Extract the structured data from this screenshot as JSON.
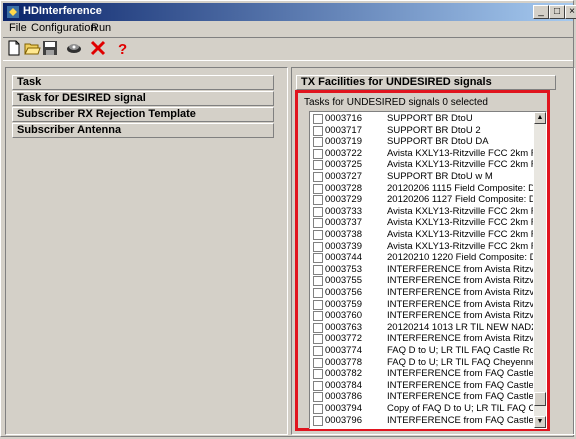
{
  "window": {
    "title": "HDInterference"
  },
  "menu": [
    "File",
    "Configuration",
    "Run"
  ],
  "toolbar": {
    "icons": [
      "new-document-icon",
      "open-folder-icon",
      "save-icon",
      "run-icon",
      "delete-icon",
      "help-icon"
    ]
  },
  "left": {
    "sections": [
      "Task",
      "Task for DESIRED signal",
      "Subscriber RX Rejection Template",
      "Subscriber Antenna"
    ]
  },
  "right": {
    "header": "TX Facilities for UNDESIRED signals",
    "subheader": "Tasks for UNDESIRED signals 0 selected",
    "rows": [
      {
        "id": "0003716",
        "name": "SUPPORT BR DtoU"
      },
      {
        "id": "0003717",
        "name": "SUPPORT BR DtoU 2"
      },
      {
        "id": "0003719",
        "name": "SUPPORT BR DtoU DA"
      },
      {
        "id": "0003722",
        "name": "Avista KXLY13-Ritzville FCC 2km R10"
      },
      {
        "id": "0003725",
        "name": "Avista KXLY13-Ritzville FCC 2km R10"
      },
      {
        "id": "0003727",
        "name": "SUPPORT BR DtoU w M"
      },
      {
        "id": "0003728",
        "name": "20120206 1115 Field Composite: D/U Ra"
      },
      {
        "id": "0003729",
        "name": "20120206 1127 Field Composite: D/U Ra"
      },
      {
        "id": "0003733",
        "name": "Avista KXLY13-Ritzville FCC 2km R10"
      },
      {
        "id": "0003737",
        "name": "Avista KXLY13-Ritzville FCC 2km R10"
      },
      {
        "id": "0003738",
        "name": "Avista KXLY13-Ritzville FCC 2km R10"
      },
      {
        "id": "0003739",
        "name": "Avista KXLY13-Ritzville FCC 2km R10"
      },
      {
        "id": "0003744",
        "name": "20120210 1220 Field Composite: D/U Ra"
      },
      {
        "id": "0003753",
        "name": "INTERFERENCE from Avista Ritzville Of"
      },
      {
        "id": "0003755",
        "name": "INTERFERENCE from Avista Ritzville Of"
      },
      {
        "id": "0003756",
        "name": "INTERFERENCE from Avista Ritzville Of"
      },
      {
        "id": "0003759",
        "name": "INTERFERENCE from Avista Ritzville Of"
      },
      {
        "id": "0003760",
        "name": "INTERFERENCE from Avista Ritzville Of"
      },
      {
        "id": "0003763",
        "name": "20120214 1013 LR TIL NEW NAD27 Ch"
      },
      {
        "id": "0003772",
        "name": "INTERFERENCE from Avista Ritzville Of"
      },
      {
        "id": "0003774",
        "name": "FAQ D to U; LR TIL FAQ Castle Rock Ch"
      },
      {
        "id": "0003778",
        "name": "FAQ D to U; LR TIL FAQ Cheyenne Mou"
      },
      {
        "id": "0003782",
        "name": "INTERFERENCE from FAQ Castle Rock"
      },
      {
        "id": "0003784",
        "name": "INTERFERENCE from FAQ Castle Rock"
      },
      {
        "id": "0003786",
        "name": "INTERFERENCE from FAQ Castle Rock"
      },
      {
        "id": "0003794",
        "name": "Copy of FAQ D to U; LR TIL FAQ Cheyer"
      },
      {
        "id": "0003796",
        "name": "INTERFERENCE from FAQ Castle Rock"
      }
    ]
  },
  "colors": {
    "titlebar_start": "#0a246a",
    "titlebar_end": "#a6caf0",
    "highlight_frame": "#e0141e"
  }
}
